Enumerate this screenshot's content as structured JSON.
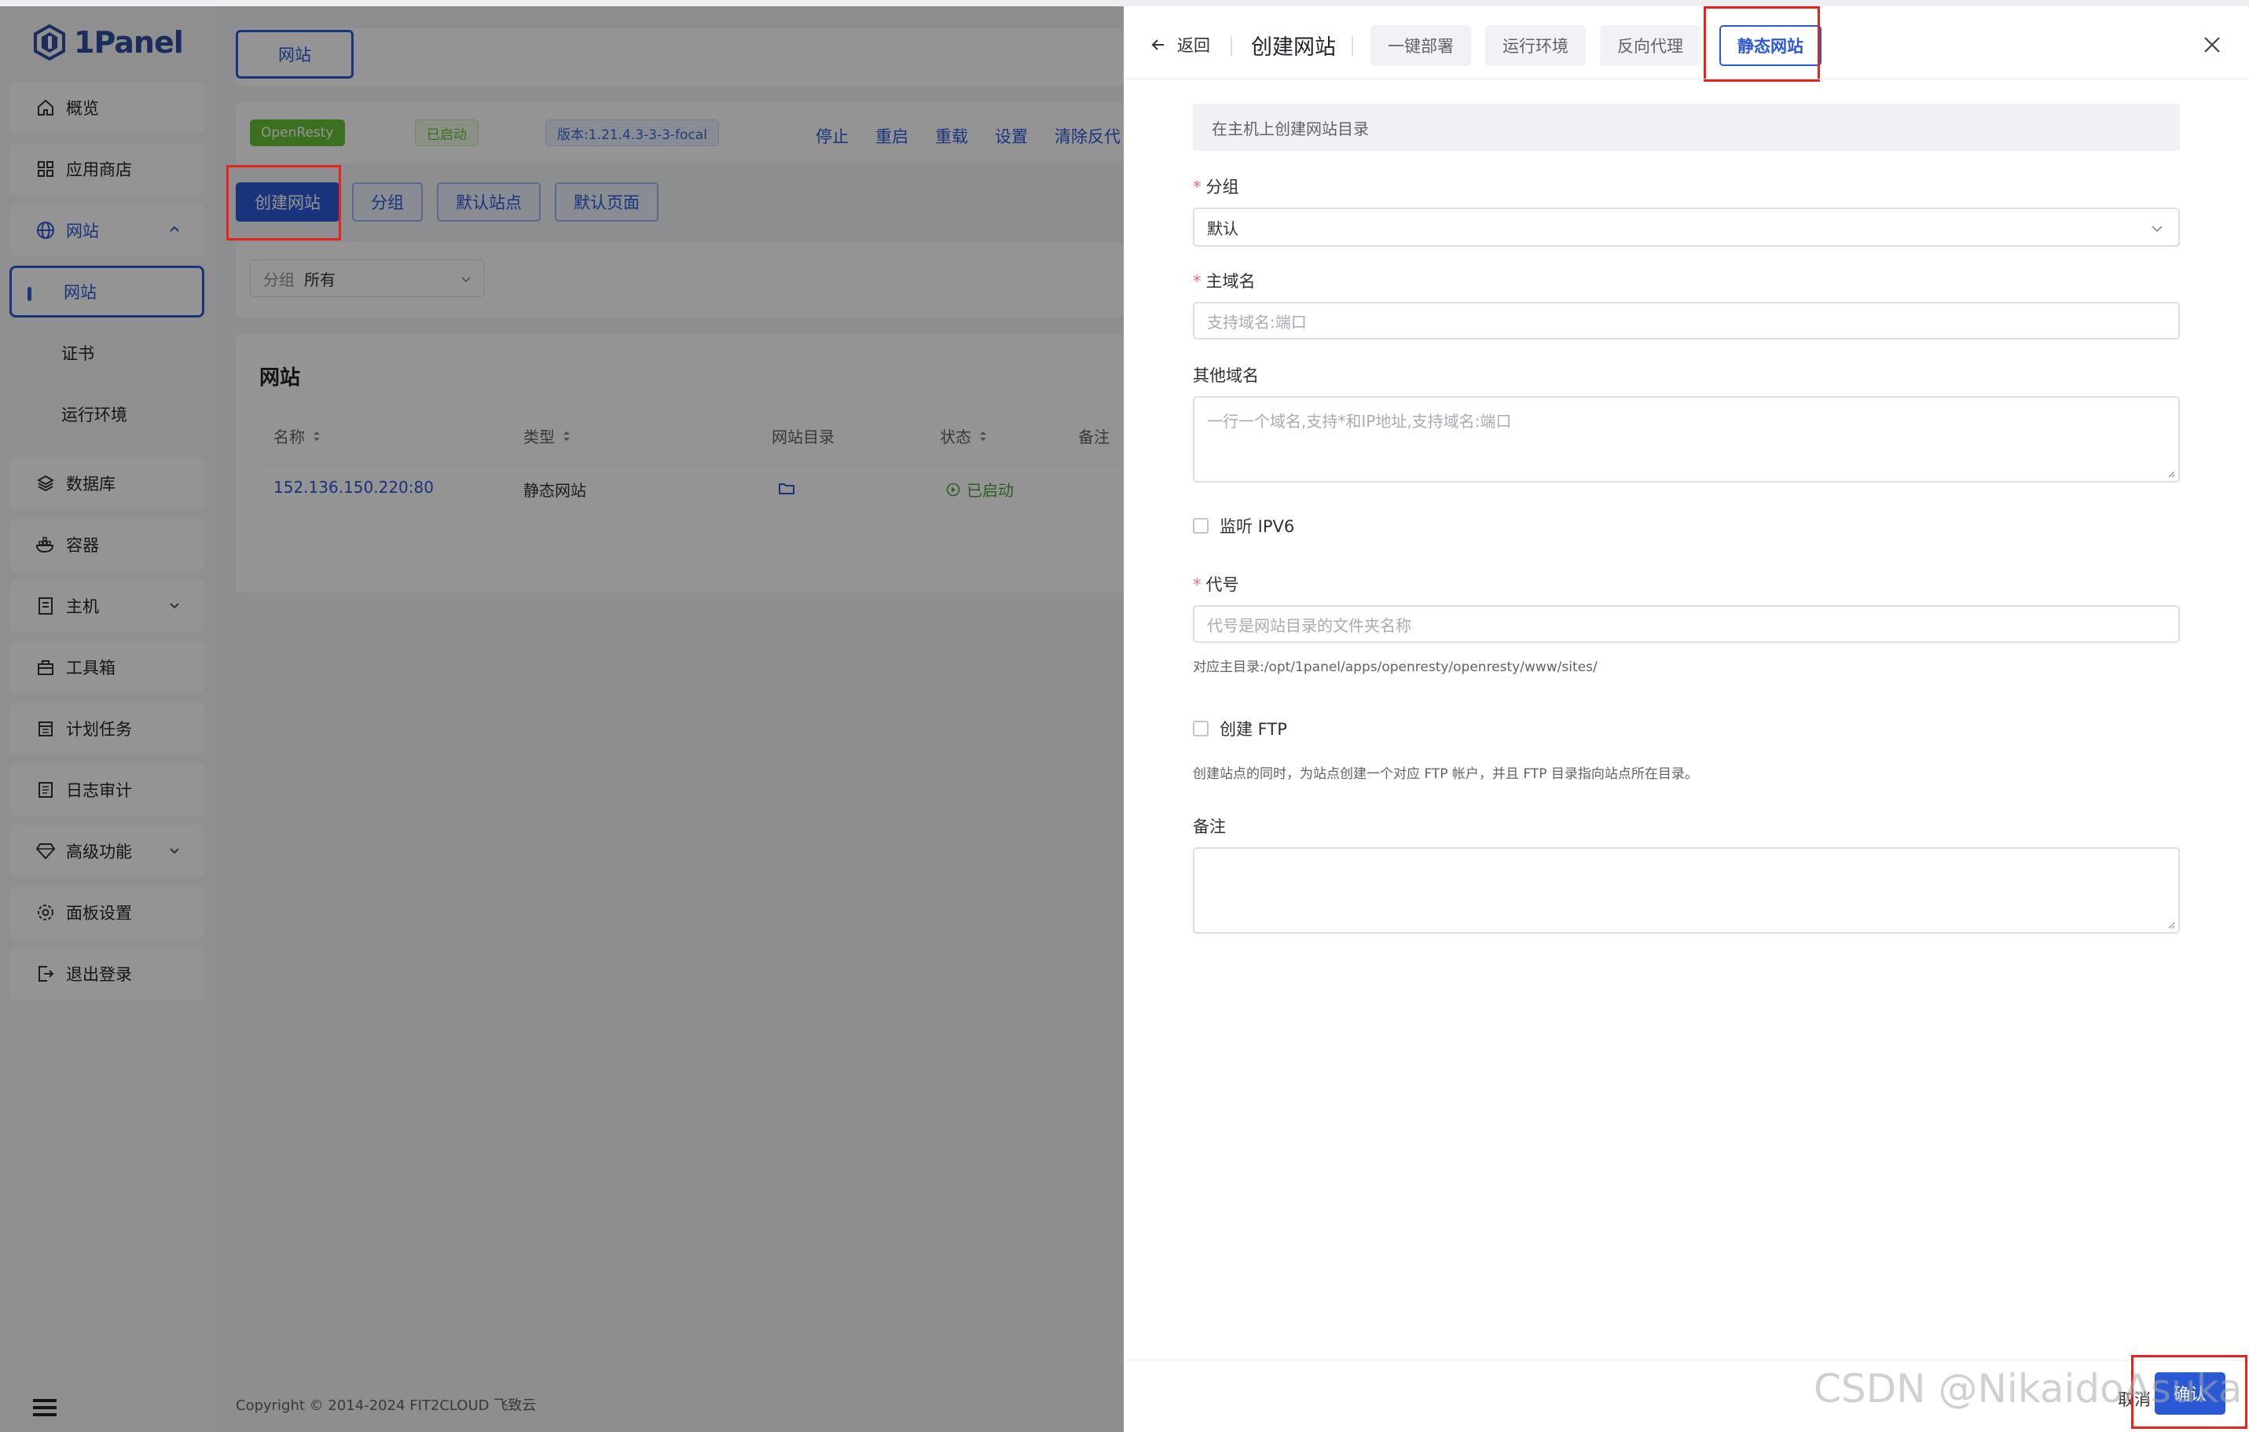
{
  "brand": {
    "name": "1Panel"
  },
  "sidebar": {
    "items": [
      {
        "label": "概览",
        "icon": "home-icon"
      },
      {
        "label": "应用商店",
        "icon": "apps-icon"
      },
      {
        "label": "网站",
        "icon": "globe-icon"
      },
      {
        "label": "网站"
      },
      {
        "label": "证书"
      },
      {
        "label": "运行环境"
      },
      {
        "label": "数据库",
        "icon": "database-icon"
      },
      {
        "label": "容器",
        "icon": "docker-icon"
      },
      {
        "label": "主机",
        "icon": "host-icon"
      },
      {
        "label": "工具箱",
        "icon": "toolbox-icon"
      },
      {
        "label": "计划任务",
        "icon": "calendar-icon"
      },
      {
        "label": "日志审计",
        "icon": "log-icon"
      },
      {
        "label": "高级功能",
        "icon": "diamond-icon"
      },
      {
        "label": "面板设置",
        "icon": "settings-icon"
      },
      {
        "label": "退出登录",
        "icon": "logout-icon"
      }
    ]
  },
  "main": {
    "tab": "网站",
    "app_tag": "OpenResty",
    "status_tag": "已启动",
    "version_tag": "版本:1.21.4.3-3-3-focal",
    "ops": [
      "停止",
      "重启",
      "重载",
      "设置",
      "清除反代"
    ],
    "buttons": [
      "创建网站",
      "分组",
      "默认站点",
      "默认页面"
    ],
    "filter": {
      "label": "分组",
      "value": "所有"
    },
    "table": {
      "title": "网站",
      "columns": [
        "名称",
        "类型",
        "网站目录",
        "状态",
        "备注"
      ],
      "rows": [
        {
          "name": "152.136.150.220:80",
          "type": "静态网站",
          "status": "已启动"
        }
      ]
    },
    "footer": "Copyright © 2014-2024 FIT2CLOUD 飞致云"
  },
  "drawer": {
    "back": "返回",
    "title": "创建网站",
    "tabs": [
      "一键部署",
      "运行环境",
      "反向代理",
      "静态网站"
    ],
    "active_tab": "静态网站",
    "banner": "在主机上创建网站目录",
    "group": {
      "label": "分组",
      "value": "默认"
    },
    "domain": {
      "label": "主域名",
      "placeholder": "支持域名:端口"
    },
    "other_domains": {
      "label": "其他域名",
      "placeholder": "一行一个域名,支持*和IP地址,支持域名:端口"
    },
    "ipv6": {
      "label": "监听 IPV6",
      "checked": false
    },
    "alias": {
      "label": "代号",
      "placeholder": "代号是网站目录的文件夹名称",
      "help": "对应主目录:/opt/1panel/apps/openresty/openresty/www/sites/"
    },
    "ftp": {
      "label": "创建 FTP",
      "checked": false,
      "help": "创建站点的同时，为站点创建一个对应 FTP 帐户，并且 FTP 目录指向站点所在目录。"
    },
    "remark": {
      "label": "备注"
    },
    "cancel": "取消",
    "confirm": "确认"
  },
  "watermark": "CSDN @NikaidoAsuka",
  "colors": {
    "primary": "#2b59d6",
    "highlight": "#e8231d",
    "success": "#67c23a"
  }
}
